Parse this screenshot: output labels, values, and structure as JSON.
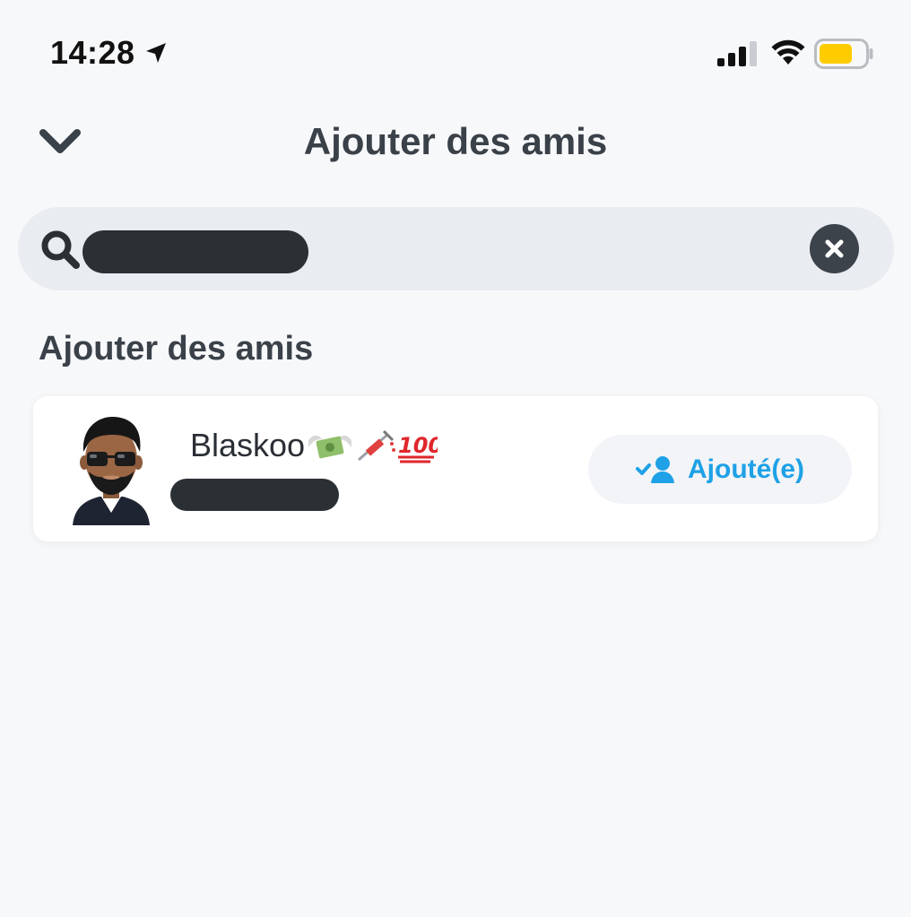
{
  "status_bar": {
    "time": "14:28",
    "location_icon": "location-arrow-icon",
    "signal_icon": "cellular-signal-icon",
    "wifi_icon": "wifi-icon",
    "battery_icon": "battery-icon",
    "battery_color": "#ffcc00"
  },
  "header": {
    "back_icon": "chevron-down-icon",
    "title": "Ajouter des amis"
  },
  "search": {
    "value": "",
    "search_icon": "search-icon",
    "clear_icon": "clear-icon"
  },
  "section": {
    "title": "Ajouter des amis"
  },
  "results": [
    {
      "display_name": "Blaskoo",
      "emojis": [
        "money-with-wings-icon",
        "syringe-icon",
        "hundred-points-icon"
      ],
      "avatar_icon": "bitmoji-avatar",
      "action_label": "Ajouté(e)",
      "action_icon": "friend-added-icon"
    }
  ],
  "colors": {
    "accent": "#1ea1e6",
    "text": "#3a4149",
    "background": "#f7f8fa",
    "search_background": "#e9ecf0"
  }
}
